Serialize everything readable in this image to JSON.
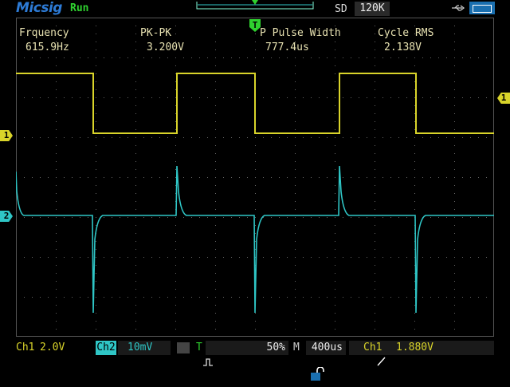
{
  "header": {
    "brand": "Micsig",
    "run_state": "Run",
    "acq_mode": "SD",
    "memory_depth": "120K"
  },
  "measurements": [
    {
      "label": "Frquency",
      "value": "615.9Hz"
    },
    {
      "label": "PK-PK",
      "value": "3.200V"
    },
    {
      "label": "P Pulse Width",
      "value": "777.4us"
    },
    {
      "label": "Cycle RMS",
      "value": "2.138V"
    }
  ],
  "markers": {
    "ch1": "1",
    "ch2": "2",
    "trigger_level": "1",
    "trigger_pos": "T"
  },
  "bottom": {
    "ch1_label": "Ch1",
    "ch1_scale": "2.0V",
    "ch2_label": "Ch2",
    "ch2_scale": "10mV",
    "trigger_mode_letter": "T",
    "horizontal_position": "50%",
    "mem_letter": "M",
    "timebase": "400us",
    "trigger_source": "Ch1",
    "trigger_level": "1.880V"
  },
  "colors": {
    "ch1": "#d9d42a",
    "ch2": "#2fc6c6",
    "run": "#2fd12f",
    "brand": "#2d7bd6"
  },
  "icons": [
    "usb-icon",
    "battery-icon",
    "lock-icon",
    "trigger-mode-icon",
    "trigger-edge-icon"
  ]
}
